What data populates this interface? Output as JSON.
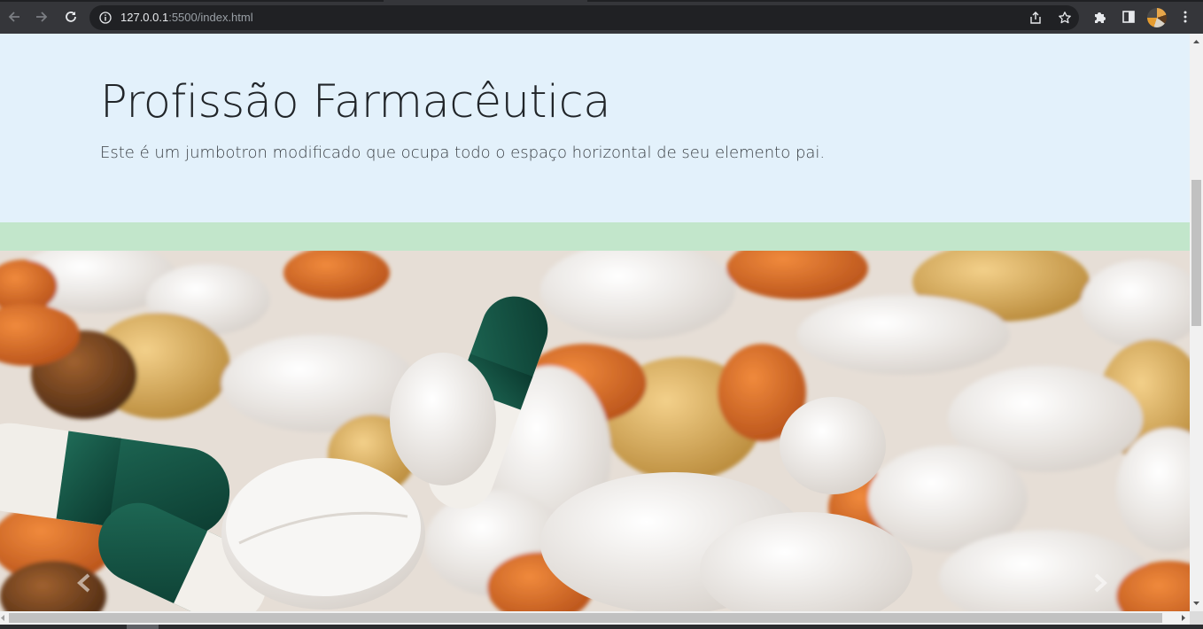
{
  "browser": {
    "url_host": "127.0.0.1",
    "url_rest": ":5500/index.html",
    "buttons": {
      "back": "back-arrow-icon",
      "forward": "forward-arrow-icon",
      "reload": "reload-icon",
      "site_info": "info-icon",
      "share": "share-icon",
      "bookmark": "star-icon",
      "extensions": "puzzle-icon",
      "side_panel": "side-panel-icon",
      "menu": "kebab-menu-icon"
    }
  },
  "jumbotron": {
    "title": "Profissão Farmacêutica",
    "lead": "Este é um jumbotron modificado que ocupa todo o espaço horizontal de seu elemento pai."
  },
  "colors": {
    "jumbotron_bg": "#e3f1fb",
    "green_bar": "#c2e6cb",
    "browser_chrome": "#35363a"
  },
  "carousel": {
    "image": "pills and capsules photo",
    "prev_icon": "chevron-left-icon",
    "next_icon": "chevron-right-icon"
  }
}
